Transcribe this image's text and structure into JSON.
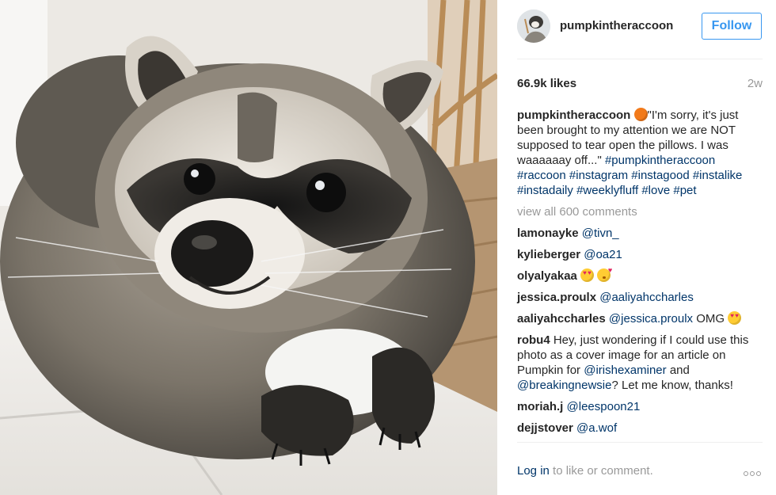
{
  "post": {
    "image_alt": "raccoon-photo",
    "username": "pumpkintheraccoon",
    "follow_label": "Follow",
    "likes": "66.9k likes",
    "time": "2w",
    "caption": {
      "user": "pumpkintheraccoon",
      "emoji": "pumpkin",
      "text": "\"I'm sorry, it's just been brought to my attention we are NOT supposed to tear open the pillows. I was waaaaaay off...\"",
      "hashtags": [
        "#pumpkintheraccoon",
        "#raccoon",
        "#instagram",
        "#instagood",
        "#instalike",
        "#instadaily",
        "#weeklyfluff",
        "#love",
        "#pet"
      ]
    },
    "view_all": "view all 600 comments",
    "comments": [
      {
        "user": "lamonayke",
        "mention": "@tivn_"
      },
      {
        "user": "kylieberger",
        "mention": "@oa21"
      },
      {
        "user": "olyalyakaa",
        "emojis": [
          "heart-eyes",
          "kiss"
        ]
      },
      {
        "user": "jessica.proulx",
        "mention": "@aaliyahccharles"
      },
      {
        "user": "aaliyahccharles",
        "mention": "@jessica.proulx",
        "text": "OMG",
        "emojis": [
          "heart-eyes"
        ]
      },
      {
        "user": "robu4",
        "text_a": "Hey, just wondering if I could use this photo as a cover image for an article on Pumpkin for",
        "mention_a": "@irishexaminer",
        "text_b": "and",
        "mention_b": "@breakingnewsie",
        "text_c": "? Let me know, thanks!"
      },
      {
        "user": "moriah.j",
        "mention": "@leespoon21"
      },
      {
        "user": "dejjstover",
        "mention": "@a.wof"
      }
    ],
    "footer": {
      "login": "Log in",
      "rest": "to like or comment.",
      "more_icon": "more-options-icon"
    }
  },
  "colors": {
    "link": "#003569",
    "follow": "#3897f0",
    "muted": "#999999",
    "text": "#262626"
  }
}
